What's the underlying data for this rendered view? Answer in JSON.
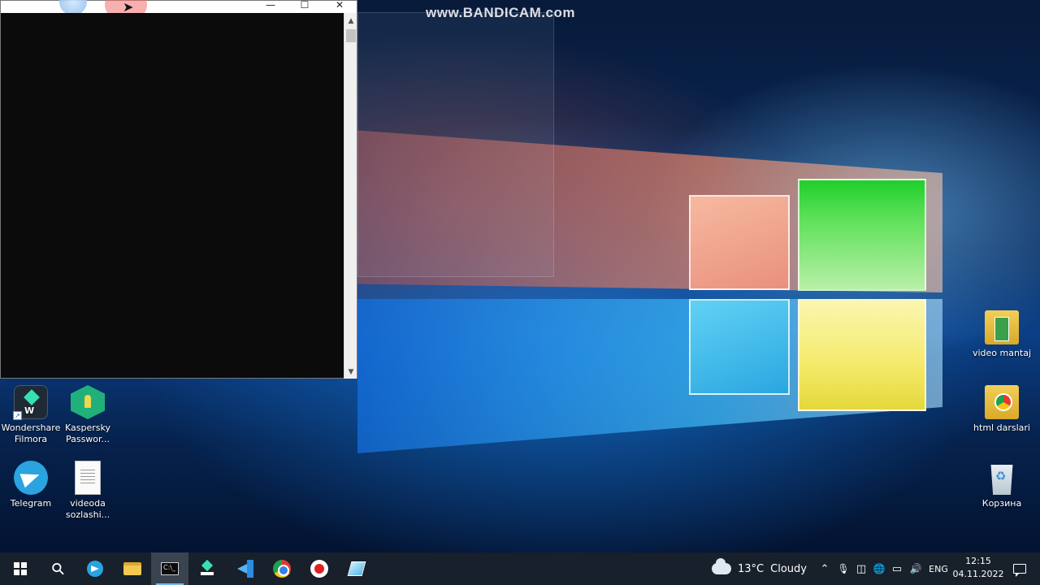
{
  "watermark": "www.BANDICAM.com",
  "console": {
    "window_buttons": {
      "minimize": "—",
      "maximize": "☐",
      "close": "✕"
    },
    "scroll_up": "▲",
    "scroll_down": "▼"
  },
  "desktop_icons": [
    {
      "label_line1": "Wondershare",
      "label_line2": "Filmora",
      "icon": "filmora-icon"
    },
    {
      "label_line1": "Kaspersky",
      "label_line2": "Passwor...",
      "icon": "kaspersky-password-icon"
    },
    {
      "label_line1": "Telegram",
      "label_line2": "",
      "icon": "telegram-icon"
    },
    {
      "label_line1": "videoda",
      "label_line2": "sozlashi...",
      "icon": "text-document-icon"
    },
    {
      "label_line1": "video mantaj",
      "label_line2": "",
      "icon": "folder-icon"
    },
    {
      "label_line1": "html darslari",
      "label_line2": "",
      "icon": "chrome-folder-icon"
    },
    {
      "label_line1": "Корзина",
      "label_line2": "",
      "icon": "recycle-bin-icon"
    }
  ],
  "taskbar": {
    "search_glyph": "⚲",
    "weather": {
      "temp": "13°C",
      "condition": "Cloudy"
    },
    "tray": {
      "chevron": "⌃",
      "mic": "🎙",
      "camera": "◫",
      "network": "🌐",
      "battery": "▭",
      "volume": "🔊",
      "language": "ENG"
    },
    "time": "12:15",
    "date": "04.11.2022",
    "cmd_glyph": "C:\\_"
  }
}
